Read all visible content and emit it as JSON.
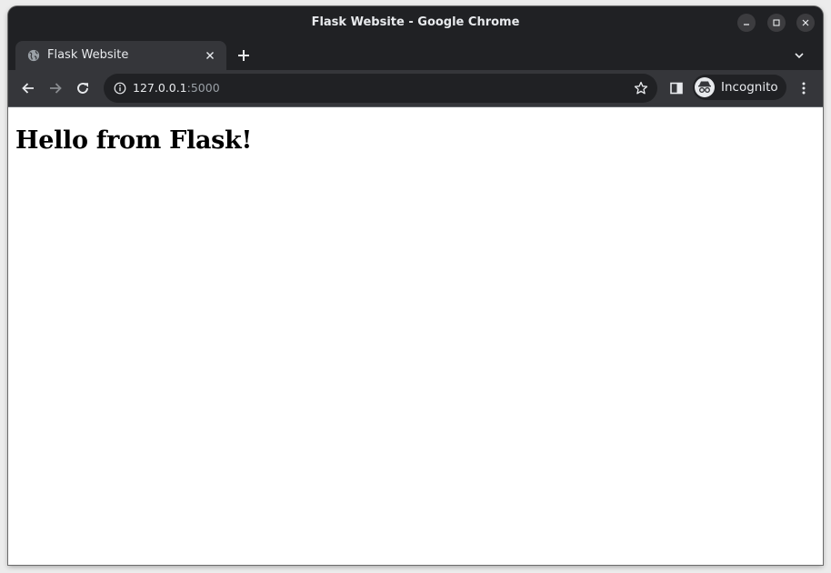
{
  "window": {
    "title": "Flask Website - Google Chrome"
  },
  "tabs": [
    {
      "title": "Flask Website",
      "active": true,
      "favicon": "globe-icon"
    }
  ],
  "toolbar": {
    "url_host": "127.0.0.1",
    "url_port": ":5000",
    "profile_label": "Incognito"
  },
  "page": {
    "heading": "Hello from Flask!"
  },
  "colors": {
    "frame": "#202124",
    "toolbar": "#35363a",
    "text_light": "#e8eaed",
    "text_dim": "#9aa0a6",
    "page_bg": "#ffffff"
  }
}
